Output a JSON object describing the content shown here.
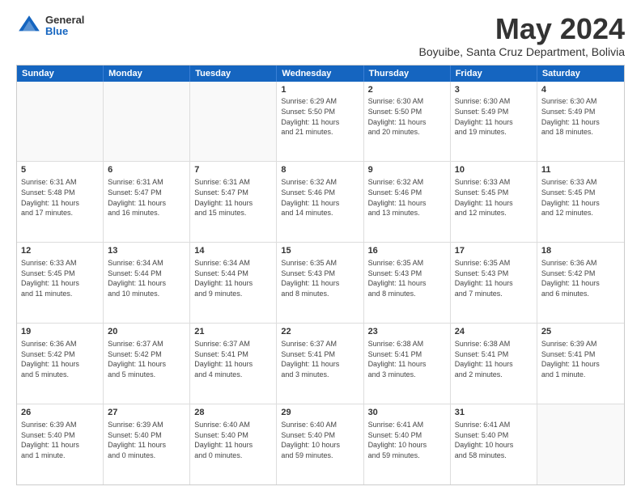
{
  "logo": {
    "general": "General",
    "blue": "Blue"
  },
  "title": "May 2024",
  "subtitle": "Boyuibe, Santa Cruz Department, Bolivia",
  "days": [
    "Sunday",
    "Monday",
    "Tuesday",
    "Wednesday",
    "Thursday",
    "Friday",
    "Saturday"
  ],
  "weeks": [
    [
      {
        "day": "",
        "info": ""
      },
      {
        "day": "",
        "info": ""
      },
      {
        "day": "",
        "info": ""
      },
      {
        "day": "1",
        "info": "Sunrise: 6:29 AM\nSunset: 5:50 PM\nDaylight: 11 hours\nand 21 minutes."
      },
      {
        "day": "2",
        "info": "Sunrise: 6:30 AM\nSunset: 5:50 PM\nDaylight: 11 hours\nand 20 minutes."
      },
      {
        "day": "3",
        "info": "Sunrise: 6:30 AM\nSunset: 5:49 PM\nDaylight: 11 hours\nand 19 minutes."
      },
      {
        "day": "4",
        "info": "Sunrise: 6:30 AM\nSunset: 5:49 PM\nDaylight: 11 hours\nand 18 minutes."
      }
    ],
    [
      {
        "day": "5",
        "info": "Sunrise: 6:31 AM\nSunset: 5:48 PM\nDaylight: 11 hours\nand 17 minutes."
      },
      {
        "day": "6",
        "info": "Sunrise: 6:31 AM\nSunset: 5:47 PM\nDaylight: 11 hours\nand 16 minutes."
      },
      {
        "day": "7",
        "info": "Sunrise: 6:31 AM\nSunset: 5:47 PM\nDaylight: 11 hours\nand 15 minutes."
      },
      {
        "day": "8",
        "info": "Sunrise: 6:32 AM\nSunset: 5:46 PM\nDaylight: 11 hours\nand 14 minutes."
      },
      {
        "day": "9",
        "info": "Sunrise: 6:32 AM\nSunset: 5:46 PM\nDaylight: 11 hours\nand 13 minutes."
      },
      {
        "day": "10",
        "info": "Sunrise: 6:33 AM\nSunset: 5:45 PM\nDaylight: 11 hours\nand 12 minutes."
      },
      {
        "day": "11",
        "info": "Sunrise: 6:33 AM\nSunset: 5:45 PM\nDaylight: 11 hours\nand 12 minutes."
      }
    ],
    [
      {
        "day": "12",
        "info": "Sunrise: 6:33 AM\nSunset: 5:45 PM\nDaylight: 11 hours\nand 11 minutes."
      },
      {
        "day": "13",
        "info": "Sunrise: 6:34 AM\nSunset: 5:44 PM\nDaylight: 11 hours\nand 10 minutes."
      },
      {
        "day": "14",
        "info": "Sunrise: 6:34 AM\nSunset: 5:44 PM\nDaylight: 11 hours\nand 9 minutes."
      },
      {
        "day": "15",
        "info": "Sunrise: 6:35 AM\nSunset: 5:43 PM\nDaylight: 11 hours\nand 8 minutes."
      },
      {
        "day": "16",
        "info": "Sunrise: 6:35 AM\nSunset: 5:43 PM\nDaylight: 11 hours\nand 8 minutes."
      },
      {
        "day": "17",
        "info": "Sunrise: 6:35 AM\nSunset: 5:43 PM\nDaylight: 11 hours\nand 7 minutes."
      },
      {
        "day": "18",
        "info": "Sunrise: 6:36 AM\nSunset: 5:42 PM\nDaylight: 11 hours\nand 6 minutes."
      }
    ],
    [
      {
        "day": "19",
        "info": "Sunrise: 6:36 AM\nSunset: 5:42 PM\nDaylight: 11 hours\nand 5 minutes."
      },
      {
        "day": "20",
        "info": "Sunrise: 6:37 AM\nSunset: 5:42 PM\nDaylight: 11 hours\nand 5 minutes."
      },
      {
        "day": "21",
        "info": "Sunrise: 6:37 AM\nSunset: 5:41 PM\nDaylight: 11 hours\nand 4 minutes."
      },
      {
        "day": "22",
        "info": "Sunrise: 6:37 AM\nSunset: 5:41 PM\nDaylight: 11 hours\nand 3 minutes."
      },
      {
        "day": "23",
        "info": "Sunrise: 6:38 AM\nSunset: 5:41 PM\nDaylight: 11 hours\nand 3 minutes."
      },
      {
        "day": "24",
        "info": "Sunrise: 6:38 AM\nSunset: 5:41 PM\nDaylight: 11 hours\nand 2 minutes."
      },
      {
        "day": "25",
        "info": "Sunrise: 6:39 AM\nSunset: 5:41 PM\nDaylight: 11 hours\nand 1 minute."
      }
    ],
    [
      {
        "day": "26",
        "info": "Sunrise: 6:39 AM\nSunset: 5:40 PM\nDaylight: 11 hours\nand 1 minute."
      },
      {
        "day": "27",
        "info": "Sunrise: 6:39 AM\nSunset: 5:40 PM\nDaylight: 11 hours\nand 0 minutes."
      },
      {
        "day": "28",
        "info": "Sunrise: 6:40 AM\nSunset: 5:40 PM\nDaylight: 11 hours\nand 0 minutes."
      },
      {
        "day": "29",
        "info": "Sunrise: 6:40 AM\nSunset: 5:40 PM\nDaylight: 10 hours\nand 59 minutes."
      },
      {
        "day": "30",
        "info": "Sunrise: 6:41 AM\nSunset: 5:40 PM\nDaylight: 10 hours\nand 59 minutes."
      },
      {
        "day": "31",
        "info": "Sunrise: 6:41 AM\nSunset: 5:40 PM\nDaylight: 10 hours\nand 58 minutes."
      },
      {
        "day": "",
        "info": ""
      }
    ]
  ]
}
